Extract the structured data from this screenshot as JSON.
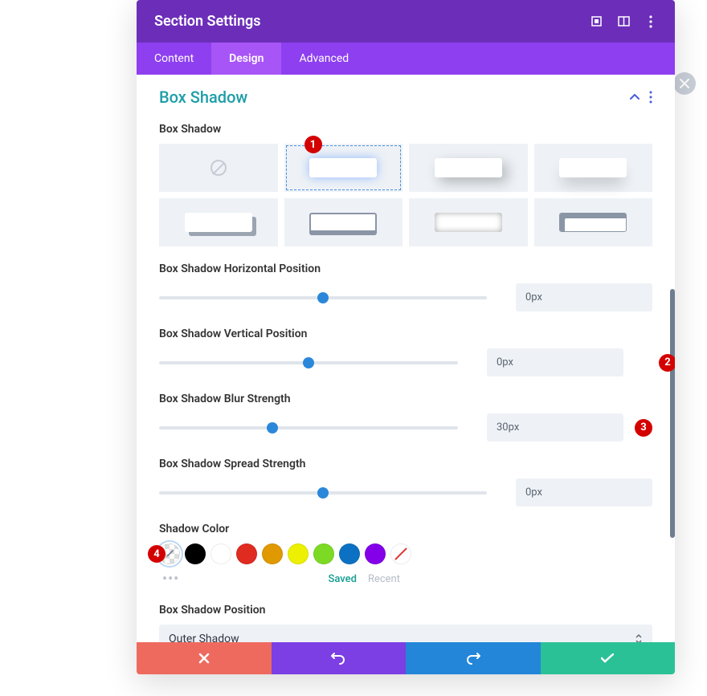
{
  "header": {
    "title": "Section Settings"
  },
  "tabs": {
    "content": "Content",
    "design": "Design",
    "advanced": "Advanced",
    "active": "Design"
  },
  "section": {
    "title": "Box Shadow"
  },
  "labels": {
    "presets": "Box Shadow",
    "horizontal": "Box Shadow Horizontal Position",
    "vertical": "Box Shadow Vertical Position",
    "blur": "Box Shadow Blur Strength",
    "spread": "Box Shadow Spread Strength",
    "color": "Shadow Color",
    "position": "Box Shadow Position"
  },
  "sliders": {
    "horizontal": {
      "value": "0px",
      "pct": 50
    },
    "vertical": {
      "value": "0px",
      "pct": 50
    },
    "blur": {
      "value": "30px",
      "pct": 38
    },
    "spread": {
      "value": "0px",
      "pct": 50
    }
  },
  "colors": {
    "swatches": [
      {
        "name": "black",
        "hex": "#000000"
      },
      {
        "name": "white",
        "hex": "#ffffff"
      },
      {
        "name": "red",
        "hex": "#e02b20"
      },
      {
        "name": "orange",
        "hex": "#e09900"
      },
      {
        "name": "yellow",
        "hex": "#edf000"
      },
      {
        "name": "green",
        "hex": "#7cda24"
      },
      {
        "name": "blue",
        "hex": "#0c71c3"
      },
      {
        "name": "purple",
        "hex": "#8300e9"
      }
    ],
    "tabs": {
      "saved": "Saved",
      "recent": "Recent"
    }
  },
  "position": {
    "selected": "Outer Shadow"
  },
  "annotations": {
    "b1": "1",
    "b2": "2",
    "b3": "3",
    "b4": "4"
  }
}
